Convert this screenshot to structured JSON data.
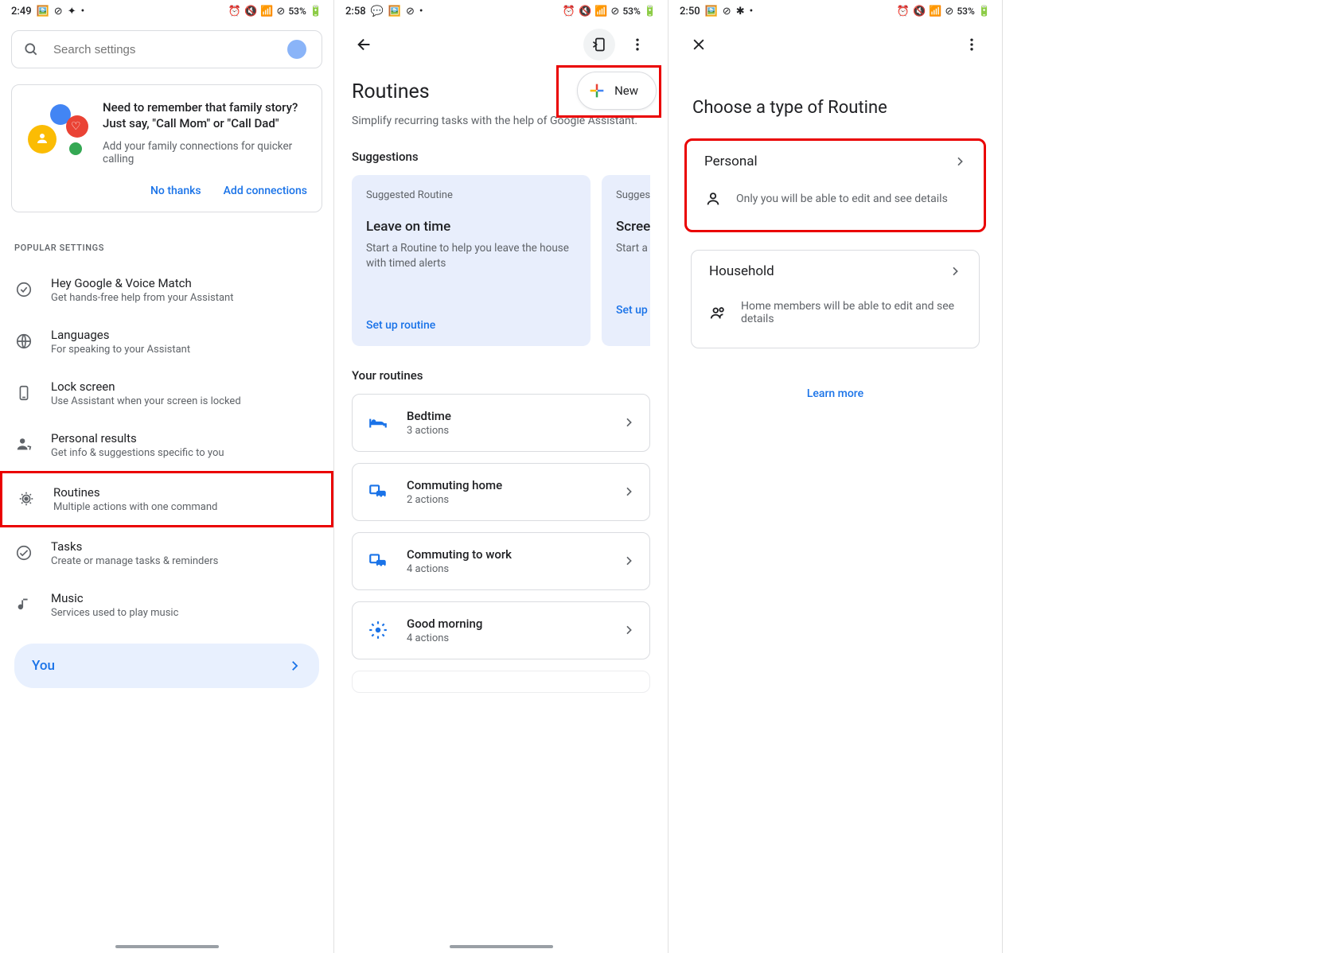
{
  "screen1": {
    "status": {
      "time": "2:49",
      "battery": "53%"
    },
    "search_placeholder": "Search settings",
    "promo": {
      "title": "Need to remember that family story? Just say, \"Call Mom\" or \"Call Dad\"",
      "sub": "Add your family connections for quicker calling",
      "no_thanks": "No thanks",
      "add": "Add connections"
    },
    "section": "POPULAR SETTINGS",
    "items": [
      {
        "title": "Hey Google & Voice Match",
        "desc": "Get hands-free help from your Assistant"
      },
      {
        "title": "Languages",
        "desc": "For speaking to your Assistant"
      },
      {
        "title": "Lock screen",
        "desc": "Use Assistant when your screen is locked"
      },
      {
        "title": "Personal results",
        "desc": "Get info & suggestions specific to you"
      },
      {
        "title": "Routines",
        "desc": "Multiple actions with one command"
      },
      {
        "title": "Tasks",
        "desc": "Create or manage tasks & reminders"
      },
      {
        "title": "Music",
        "desc": "Services used to play music"
      }
    ],
    "you": "You"
  },
  "screen2": {
    "status": {
      "time": "2:58",
      "battery": "53%"
    },
    "heading": "Routines",
    "sub": "Simplify recurring tasks with the help of Google Assistant.",
    "new_label": "New",
    "suggestions_label": "Suggestions",
    "sugg": [
      {
        "label": "Suggested Routine",
        "title": "Leave on time",
        "desc": "Start a Routine to help you leave the house with timed alerts",
        "action": "Set up routine"
      },
      {
        "label": "Suggested Routine",
        "title": "Screen time",
        "desc": "Start a routine with timed",
        "action": "Set up routine"
      }
    ],
    "your_label": "Your routines",
    "routines": [
      {
        "title": "Bedtime",
        "sub": "3 actions"
      },
      {
        "title": "Commuting home",
        "sub": "2 actions"
      },
      {
        "title": "Commuting to work",
        "sub": "4 actions"
      },
      {
        "title": "Good morning",
        "sub": "4 actions"
      }
    ]
  },
  "screen3": {
    "status": {
      "time": "2:50",
      "battery": "53%"
    },
    "heading": "Choose a type of Routine",
    "types": [
      {
        "title": "Personal",
        "desc": "Only you will be able to edit and see details"
      },
      {
        "title": "Household",
        "desc": "Home members will be able to edit and see details"
      }
    ],
    "learn": "Learn more"
  }
}
